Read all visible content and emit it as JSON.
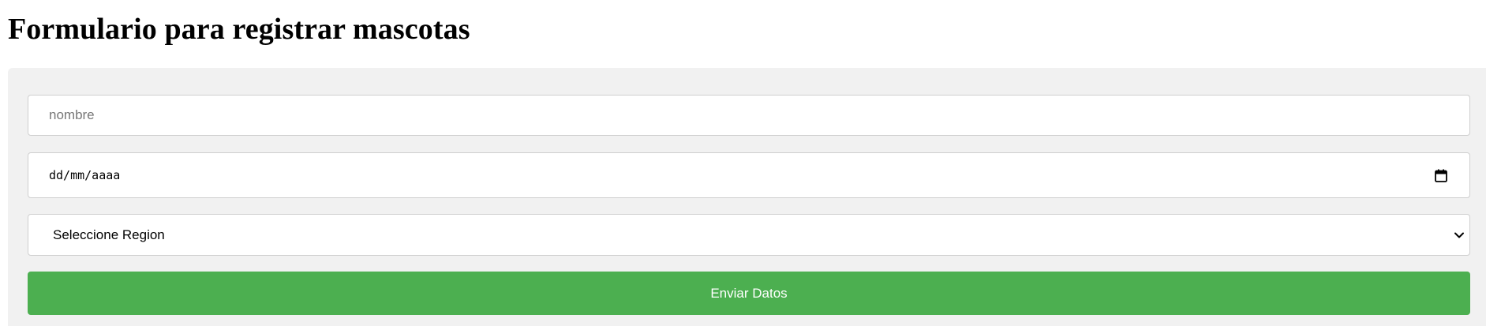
{
  "page": {
    "title": "Formulario para registrar mascotas"
  },
  "form": {
    "name_field": {
      "placeholder": "nombre",
      "value": ""
    },
    "date_field": {
      "placeholder": "dd/mm/aaaa",
      "icon": "calendar-icon"
    },
    "region_select": {
      "selected": "Seleccione Region",
      "icon": "chevron-down-icon"
    },
    "submit_button": {
      "label": "Enviar Datos",
      "color": "#4caf50"
    }
  }
}
